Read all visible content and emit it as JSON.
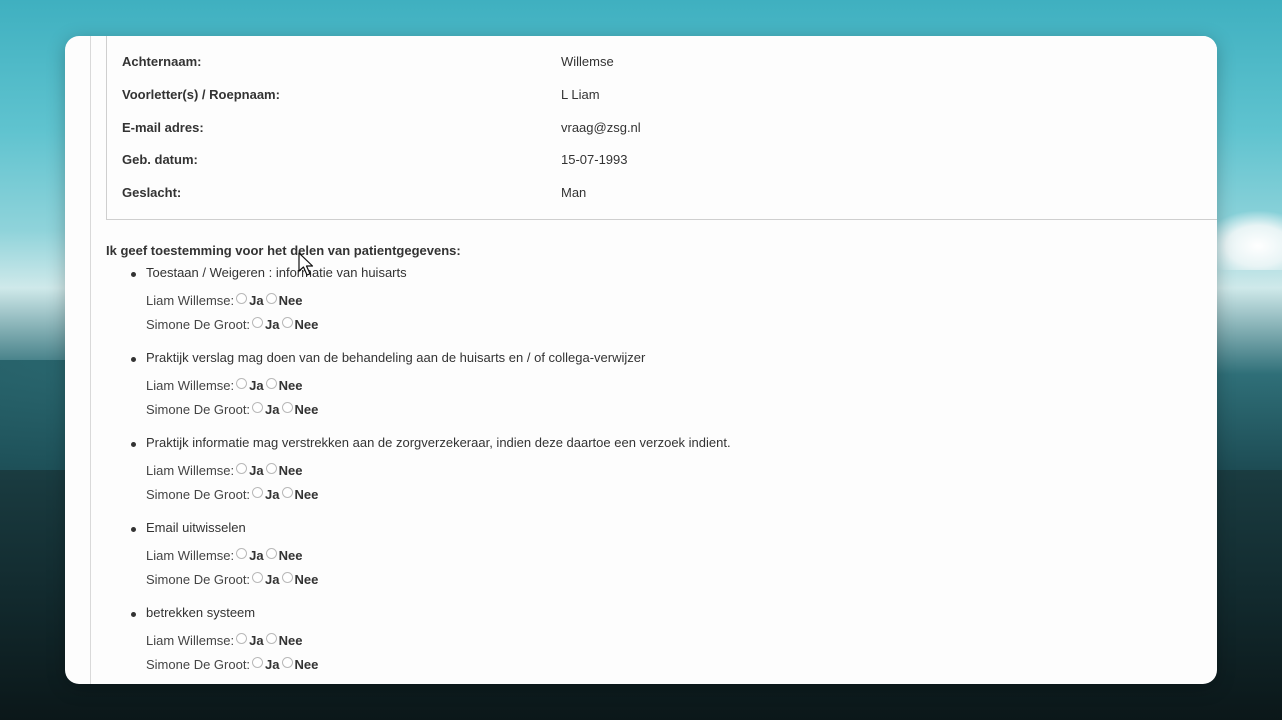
{
  "patient": {
    "rows": [
      {
        "label": "Achternaam:",
        "value": "Willemse"
      },
      {
        "label": "Voorletter(s) / Roepnaam:",
        "value": "L Liam"
      },
      {
        "label": "E-mail adres:",
        "value": "vraag@zsg.nl"
      },
      {
        "label": "Geb. datum:",
        "value": "15-07-1993"
      },
      {
        "label": "Geslacht:",
        "value": "Man"
      }
    ]
  },
  "consent": {
    "heading": "Ik geef toestemming voor het delen van patientgegevens:",
    "yes_label": "Ja",
    "no_label": "Nee",
    "items": [
      {
        "text": "Toestaan / Weigeren : informatie van huisarts",
        "persons": [
          "Liam Willemse:",
          "Simone De Groot:"
        ]
      },
      {
        "text": "Praktijk verslag mag doen van de behandeling aan de huisarts en / of collega-verwijzer",
        "persons": [
          "Liam Willemse:",
          "Simone De Groot:"
        ]
      },
      {
        "text": "Praktijk informatie mag verstrekken aan de zorgverzekeraar, indien deze daartoe een verzoek indient.",
        "persons": [
          "Liam Willemse:",
          "Simone De Groot:"
        ]
      },
      {
        "text": "Email uitwisselen",
        "persons": [
          "Liam Willemse:",
          "Simone De Groot:"
        ]
      },
      {
        "text": "betrekken systeem",
        "persons": [
          "Liam Willemse:",
          "Simone De Groot:"
        ]
      }
    ]
  }
}
